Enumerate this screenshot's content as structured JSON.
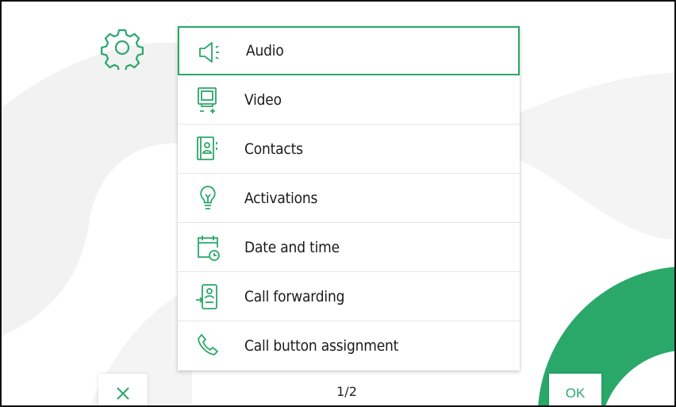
{
  "menu": {
    "items": [
      {
        "label": "Audio",
        "icon": "speaker-icon",
        "selected": true
      },
      {
        "label": "Video",
        "icon": "monitor-icon",
        "selected": false
      },
      {
        "label": "Contacts",
        "icon": "contacts-book-icon",
        "selected": false
      },
      {
        "label": "Activations",
        "icon": "lightbulb-icon",
        "selected": false
      },
      {
        "label": "Date and time",
        "icon": "calendar-clock-icon",
        "selected": false
      },
      {
        "label": "Call forwarding",
        "icon": "call-forward-phone-icon",
        "selected": false
      },
      {
        "label": "Call button assignment",
        "icon": "phone-handset-icon",
        "selected": false
      }
    ]
  },
  "footer": {
    "close_icon": "close-icon",
    "page_indicator": "1/2",
    "ok_label": "OK"
  },
  "header": {
    "settings_icon": "gear-icon"
  },
  "colors": {
    "accent": "#2aa86a",
    "background_shape": "#f1f1f1",
    "text": "#1a1a1a"
  }
}
